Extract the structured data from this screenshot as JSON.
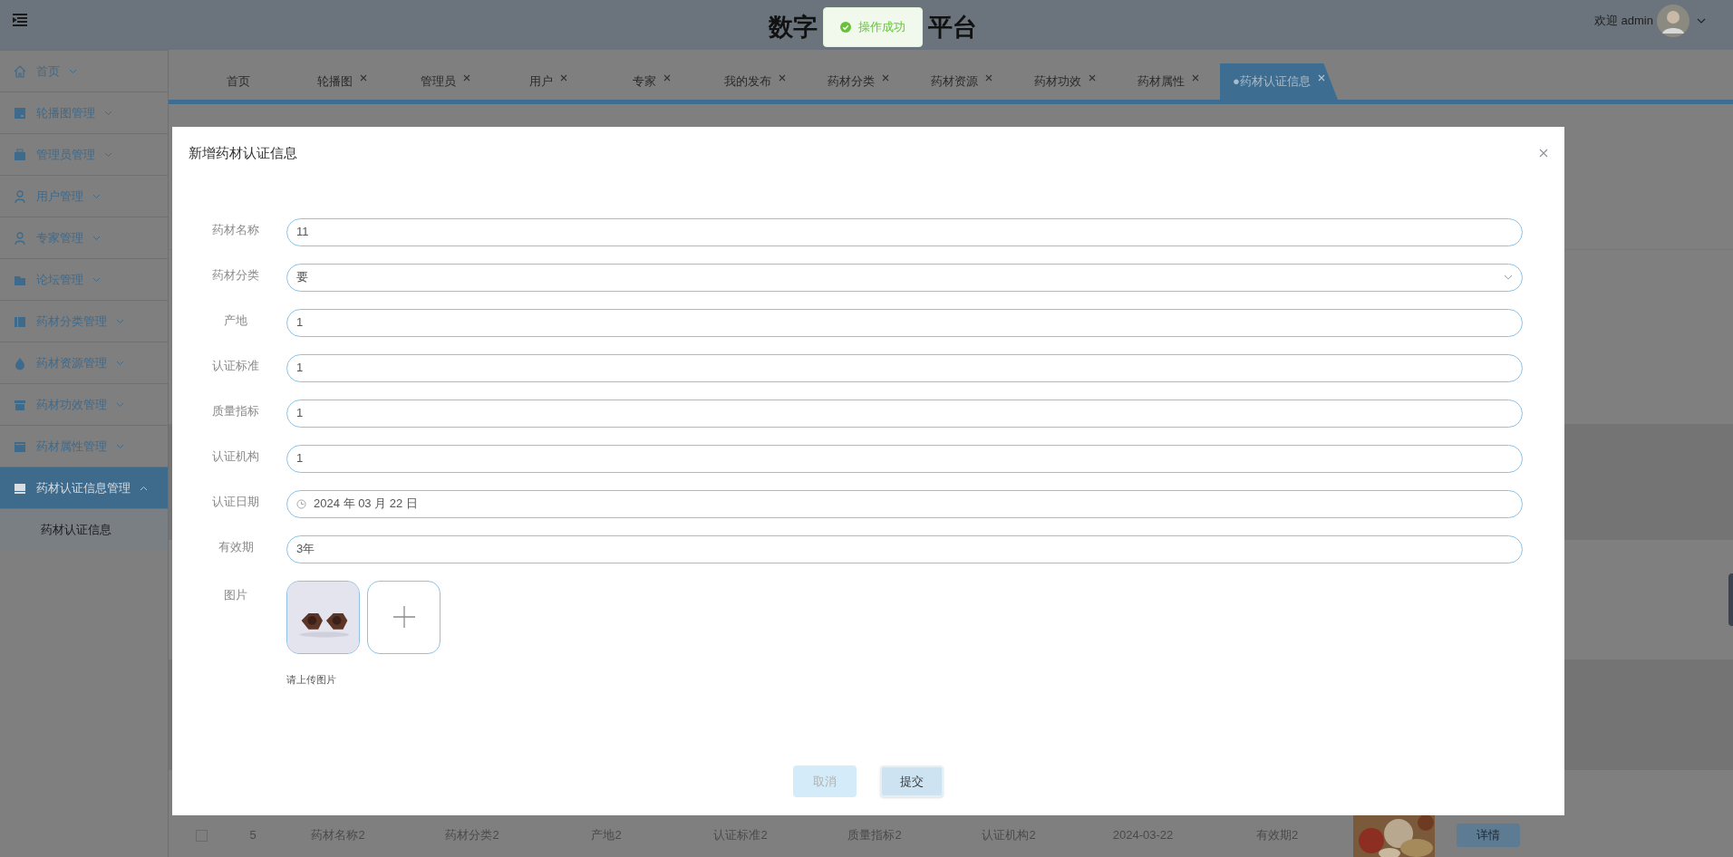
{
  "header": {
    "title_parts": [
      "数字",
      "平台"
    ],
    "toast": "操作成功",
    "greeting": "欢迎 admin"
  },
  "sidebar": {
    "items": [
      {
        "label": "首页",
        "expanded": false
      },
      {
        "label": "轮播图管理",
        "expanded": false
      },
      {
        "label": "管理员管理",
        "expanded": false
      },
      {
        "label": "用户管理",
        "expanded": false
      },
      {
        "label": "专家管理",
        "expanded": false
      },
      {
        "label": "论坛管理",
        "expanded": false
      },
      {
        "label": "药材分类管理",
        "expanded": false
      },
      {
        "label": "药材资源管理",
        "expanded": false
      },
      {
        "label": "药材功效管理",
        "expanded": false
      },
      {
        "label": "药材属性管理",
        "expanded": false
      },
      {
        "label": "药材认证信息管理",
        "expanded": true,
        "children": [
          {
            "label": "药材认证信息"
          }
        ]
      }
    ]
  },
  "tabs": [
    {
      "label": "首页",
      "closable": false,
      "selected": false
    },
    {
      "label": "轮播图",
      "closable": true,
      "selected": false
    },
    {
      "label": "管理员",
      "closable": true,
      "selected": false
    },
    {
      "label": "用户",
      "closable": true,
      "selected": false
    },
    {
      "label": "专家",
      "closable": true,
      "selected": false
    },
    {
      "label": "我的发布",
      "closable": true,
      "selected": false
    },
    {
      "label": "药材分类",
      "closable": true,
      "selected": false
    },
    {
      "label": "药材资源",
      "closable": true,
      "selected": false
    },
    {
      "label": "药材功效",
      "closable": true,
      "selected": false
    },
    {
      "label": "药材属性",
      "closable": true,
      "selected": false
    },
    {
      "label": "●药材认证信息",
      "closable": true,
      "selected": true
    }
  ],
  "table": {
    "rows": [
      {
        "checked": false,
        "cells": [
          "5",
          "药材名称2",
          "药材分类2",
          "产地2",
          "认证标准2",
          "质量指标2",
          "认证机构2",
          "2024-03-22",
          "有效期2"
        ],
        "action": "详情"
      }
    ]
  },
  "dialog": {
    "title": "新增药材认证信息",
    "fields": [
      {
        "label": "药材名称",
        "kind": "text",
        "value": "11"
      },
      {
        "label": "药材分类",
        "kind": "select",
        "value": "要"
      },
      {
        "label": "产地",
        "kind": "text",
        "value": "1"
      },
      {
        "label": "认证标准",
        "kind": "text",
        "value": "1"
      },
      {
        "label": "质量指标",
        "kind": "text",
        "value": "1"
      },
      {
        "label": "认证机构",
        "kind": "text",
        "value": "1"
      },
      {
        "label": "认证日期",
        "kind": "date",
        "value": "2024 年 03 月 22 日"
      },
      {
        "label": "有效期",
        "kind": "text",
        "value": "3年"
      }
    ],
    "upload": {
      "label": "图片",
      "hint": "请上传图片"
    },
    "buttons": [
      {
        "label": "取消",
        "kind": "cancel"
      },
      {
        "label": "提交",
        "kind": "submit"
      }
    ]
  }
}
